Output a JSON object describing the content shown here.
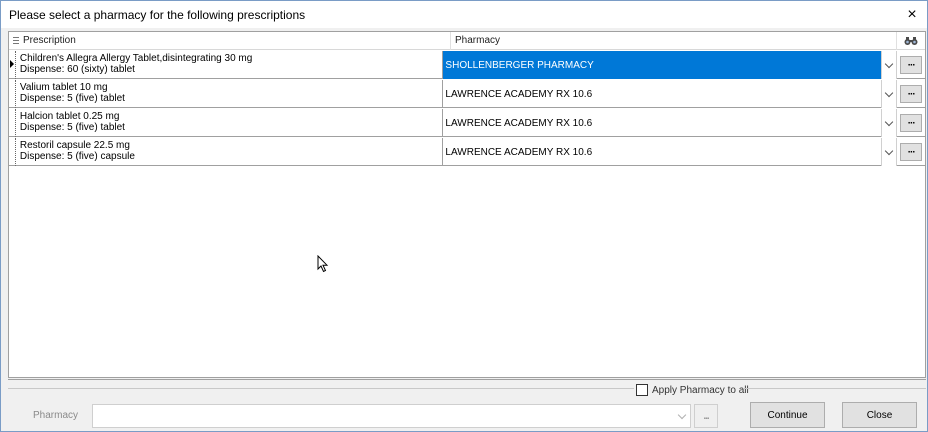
{
  "window": {
    "title": "Please select a pharmacy for the following prescriptions",
    "close_glyph": "×"
  },
  "grid": {
    "columns": {
      "prescription": "Prescription",
      "pharmacy": "Pharmacy",
      "search_icon": "binoculars-icon"
    },
    "rows": [
      {
        "line1": "Children's Allegra Allergy Tablet,disintegrating 30 mg",
        "line2": "Dispense: 60 (sixty) tablet",
        "pharmacy": "SHOLLENBERGER PHARMACY",
        "selected": true
      },
      {
        "line1": "Valium tablet 10 mg",
        "line2": "Dispense: 5 (five) tablet",
        "pharmacy": "LAWRENCE ACADEMY RX 10.6",
        "selected": false
      },
      {
        "line1": "Halcion tablet 0.25 mg",
        "line2": "Dispense: 5 (five) tablet",
        "pharmacy": "LAWRENCE ACADEMY RX 10.6",
        "selected": false
      },
      {
        "line1": "Restoril capsule 22.5 mg",
        "line2": "Dispense: 5 (five) capsule",
        "pharmacy": "LAWRENCE ACADEMY RX 10.6",
        "selected": false
      }
    ],
    "ellipsis_label": "···"
  },
  "bottom": {
    "apply_to_all_label": "Apply Pharmacy to all",
    "apply_to_all_checked": false,
    "pharmacy_label": "Pharmacy",
    "pharmacy_value": "",
    "ellipsis_label": "...",
    "continue_label": "Continue",
    "close_label": "Close"
  },
  "colors": {
    "selection": "#0078d7",
    "window_border": "#7a9cc6"
  }
}
